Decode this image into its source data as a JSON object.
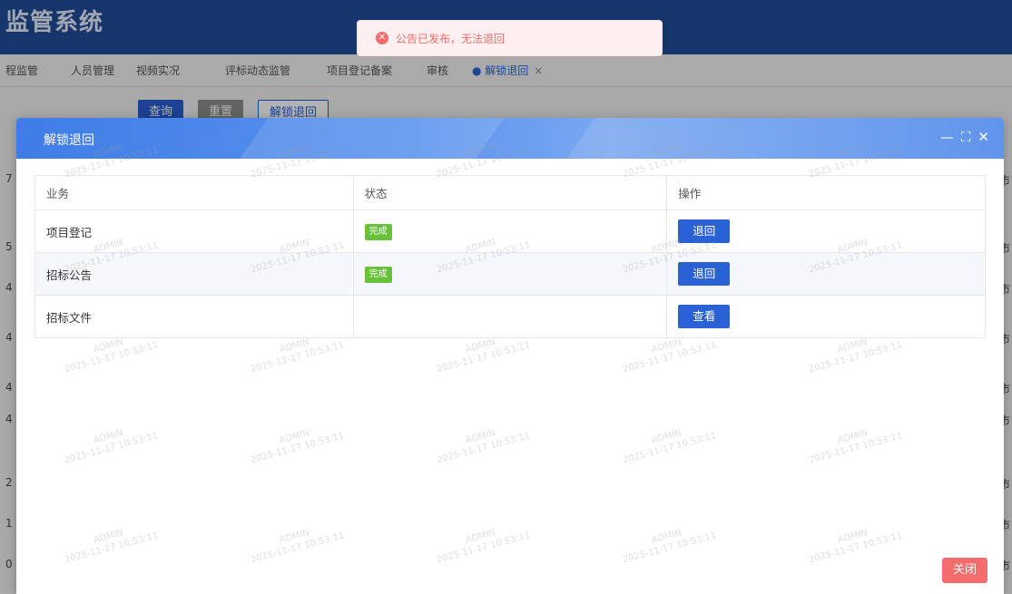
{
  "app": {
    "title": "监管系统"
  },
  "tabs": [
    {
      "label": "程监管"
    },
    {
      "label": "人员管理"
    },
    {
      "label": "视频实况"
    },
    {
      "label": "评标动态监管"
    },
    {
      "label": "项目登记备案"
    },
    {
      "label": "审核"
    },
    {
      "label": "● 解锁退回",
      "active": true,
      "close": "×"
    }
  ],
  "toolbar": {
    "query_label": "查询",
    "reset_label": "重置",
    "unlock_label": "解锁退回"
  },
  "background_rows": {
    "left_digits": [
      "7",
      "5",
      "4",
      "4",
      "4",
      "4",
      "2",
      "1",
      "0"
    ],
    "right_chars": [
      "市",
      "市",
      "市",
      "市",
      "市",
      "市",
      "市",
      "市",
      "市"
    ]
  },
  "toast": {
    "message": "公告已发布，无法退回",
    "icon": "error-circle-icon"
  },
  "dialog": {
    "title": "解锁退回",
    "tools": {
      "minimize": "—",
      "maximize": "⛶",
      "close": "✕"
    },
    "table": {
      "headers": [
        "业务",
        "状态",
        "操作"
      ],
      "rows": [
        {
          "business": "项目登记",
          "status": "完成",
          "action": "退回"
        },
        {
          "business": "招标公告",
          "status": "完成",
          "action": "退回"
        },
        {
          "business": "招标文件",
          "status": "",
          "action": "查看"
        }
      ]
    },
    "close_label": "关闭"
  },
  "watermark": {
    "user": "ADMIN",
    "time": "2025-11-17 10:53:11"
  },
  "colors": {
    "primary": "#2a62d6",
    "success": "#67c23a",
    "danger": "#f56c6c",
    "header": "#1f4d9a"
  }
}
